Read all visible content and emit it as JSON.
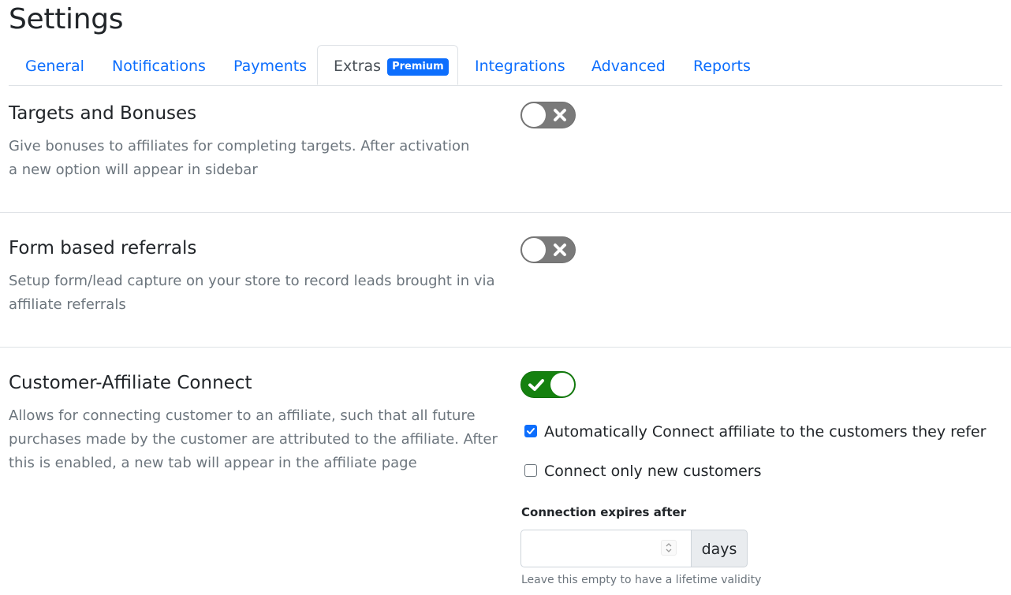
{
  "page": {
    "title": "Settings"
  },
  "tabs": [
    {
      "label": "General",
      "active": false
    },
    {
      "label": "Notifications",
      "active": false
    },
    {
      "label": "Payments",
      "active": false
    },
    {
      "label": "Extras",
      "active": true,
      "badge": "Premium"
    },
    {
      "label": "Integrations",
      "active": false
    },
    {
      "label": "Advanced",
      "active": false
    },
    {
      "label": "Reports",
      "active": false
    }
  ],
  "sections": [
    {
      "title": "Targets and Bonuses",
      "description": "Give bonuses to affiliates for completing targets. After activation a new option will appear in sidebar",
      "enabled": false
    },
    {
      "title": "Form based referrals",
      "description": "Setup form/lead capture on your store to record leads brought in via affiliate referrals",
      "enabled": false
    },
    {
      "title": "Customer-Affiliate Connect",
      "description": "Allows for connecting customer to an affiliate, such that all future purchases made by the customer are attributed to the affiliate. After this is enabled, a new tab will appear in the affiliate page",
      "enabled": true,
      "options": [
        {
          "label": "Automatically Connect affiliate to the customers they refer",
          "checked": true
        },
        {
          "label": "Connect only new customers",
          "checked": false
        }
      ],
      "expiry": {
        "label": "Connection expires after",
        "value": "",
        "placeholder": "",
        "suffix": "days",
        "help": "Leave this empty to have a lifetime validity"
      }
    }
  ],
  "colors": {
    "link": "#0d6efd",
    "toggle_off": "#7a7a7a",
    "toggle_on": "#15810f",
    "badge": "#0d6efd"
  }
}
